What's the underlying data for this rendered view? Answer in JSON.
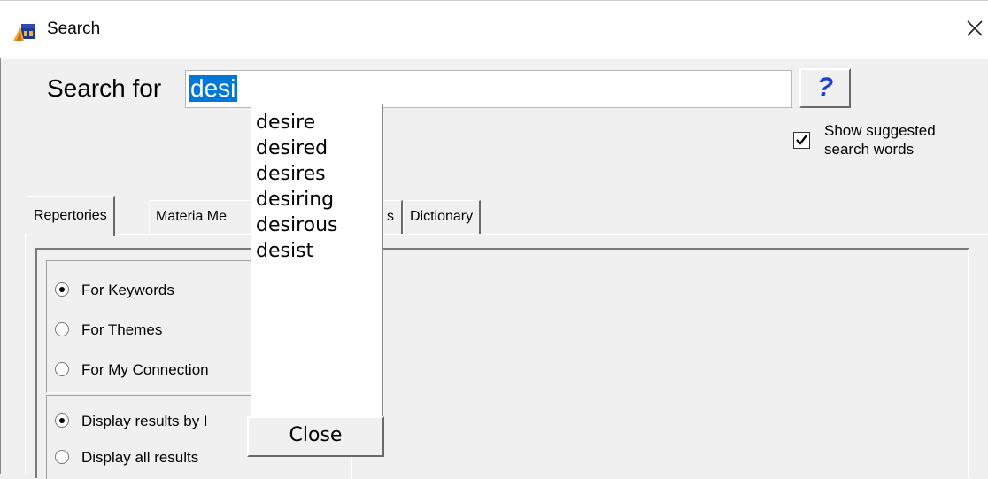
{
  "window": {
    "title": "Search",
    "app_icon": "remedy-app-icon",
    "close_icon": "close-icon"
  },
  "search": {
    "label": "Search for",
    "value": "desi",
    "help_label": "?",
    "show_suggested_checked": true,
    "show_suggested_line1": "Show suggested",
    "show_suggested_line2": "search words"
  },
  "suggestions": {
    "items": [
      "desire",
      "desired",
      "desires",
      "desiring",
      "desirous",
      "desist"
    ],
    "close_label": "Close"
  },
  "tabs": [
    {
      "label": "Repertories",
      "active": true
    },
    {
      "label": "Materia Me",
      "active": false
    },
    {
      "label": "s",
      "active": false
    },
    {
      "label": "Dictionary",
      "active": false
    }
  ],
  "search_scope": {
    "options": [
      {
        "label": "For Keywords",
        "selected": true
      },
      {
        "label": "For Themes",
        "selected": false
      },
      {
        "label": "For My Connection",
        "selected": false
      }
    ]
  },
  "display_mode": {
    "options": [
      {
        "label": "Display results by I",
        "selected": true
      },
      {
        "label": "Display all results",
        "selected": false
      }
    ]
  },
  "colors": {
    "selection": "#0078d7",
    "help_question": "#1a3fd6",
    "window_bg": "#f0f0f0"
  }
}
